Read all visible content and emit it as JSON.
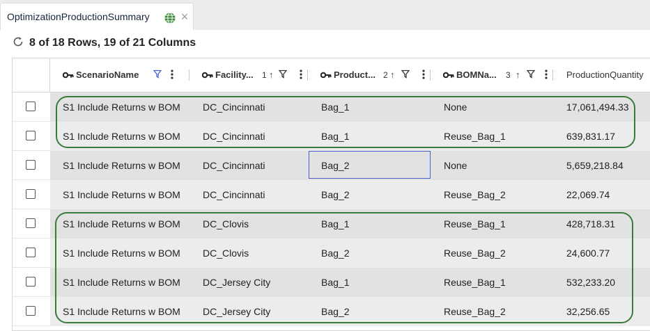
{
  "tab": {
    "title": "OptimizationProductionSummary",
    "globe_icon": "globe-icon",
    "close_icon": "close-icon"
  },
  "toolbar": {
    "row_count": "8 of 18 Rows, 19 of 21 Columns",
    "refresh_icon": "refresh-icon"
  },
  "columns": [
    {
      "label": "ScenarioName",
      "key": true,
      "sort_order": "",
      "filter_active": true
    },
    {
      "label": "Facility...",
      "key": true,
      "sort_order": "1",
      "sort": "ascending"
    },
    {
      "label": "Product...",
      "key": true,
      "sort_order": "2",
      "sort": "ascending"
    },
    {
      "label": "BOMNa...",
      "key": true,
      "sort_order": "3",
      "sort": "ascending"
    },
    {
      "label": "ProductionQuantity",
      "key": false
    }
  ],
  "rows": [
    {
      "scenario": "S1 Include Returns w BOM",
      "facility": "DC_Cincinnati",
      "product": "Bag_1",
      "bom": "None",
      "qty": "17,061,494.33"
    },
    {
      "scenario": "S1 Include Returns w BOM",
      "facility": "DC_Cincinnati",
      "product": "Bag_1",
      "bom": "Reuse_Bag_1",
      "qty": "639,831.17"
    },
    {
      "scenario": "S1 Include Returns w BOM",
      "facility": "DC_Cincinnati",
      "product": "Bag_2",
      "bom": "None",
      "qty": "5,659,218.84"
    },
    {
      "scenario": "S1 Include Returns w BOM",
      "facility": "DC_Cincinnati",
      "product": "Bag_2",
      "bom": "Reuse_Bag_2",
      "qty": "22,069.74"
    },
    {
      "scenario": "S1 Include Returns w BOM",
      "facility": "DC_Clovis",
      "product": "Bag_1",
      "bom": "Reuse_Bag_1",
      "qty": "428,718.31"
    },
    {
      "scenario": "S1 Include Returns w BOM",
      "facility": "DC_Clovis",
      "product": "Bag_2",
      "bom": "Reuse_Bag_2",
      "qty": "24,600.77"
    },
    {
      "scenario": "S1 Include Returns w BOM",
      "facility": "DC_Jersey City",
      "product": "Bag_1",
      "bom": "Reuse_Bag_1",
      "qty": "532,233.20"
    },
    {
      "scenario": "S1 Include Returns w BOM",
      "facility": "DC_Jersey City",
      "product": "Bag_2",
      "bom": "Reuse_Bag_2",
      "qty": "32,256.65"
    }
  ],
  "colors": {
    "highlight_outline": "#3a7a3a",
    "focus_border": "#4a5ecf",
    "filter_active": "#4a5ecf"
  }
}
